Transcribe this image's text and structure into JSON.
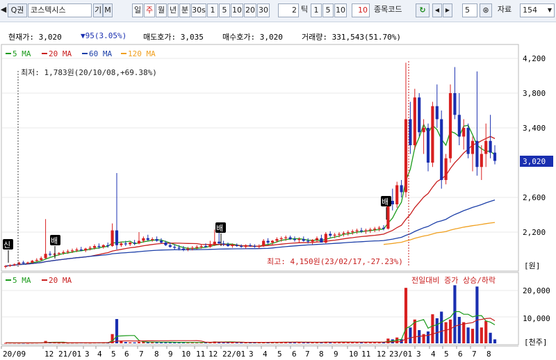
{
  "toolbar": {
    "nav_prev": "◀",
    "search_label": "Q권",
    "stock_name": "코스텍시스",
    "btn_gi": "기",
    "btn_m": "M",
    "periods": [
      "일",
      "주",
      "월",
      "년",
      "분",
      "30s"
    ],
    "period_active": "주",
    "nums1": [
      "1",
      "5",
      "10",
      "20",
      "30"
    ],
    "tick_input": "2",
    "tick_label": "틱",
    "nums2": [
      "1",
      "5",
      "10"
    ],
    "red_value": "10",
    "stock_code_label": "종목코드",
    "step_value": "5",
    "data_label": "자료",
    "data_count": "154"
  },
  "info": {
    "current_label": "현재가: 3,020",
    "change_label": "▼95(3.05%)",
    "ask_label": "매도호가: 3,035",
    "bid_label": "매수호가: 3,020",
    "volume_label": "거래량: 331,543(51.70%)"
  },
  "price_legend": [
    "5 MA",
    "20 MA",
    "60 MA",
    "120 MA"
  ],
  "volume_legend": [
    "5 MA",
    "20 MA"
  ],
  "colors": {
    "ma5": "#1a9a1a",
    "ma20": "#c81e1e",
    "ma60": "#1c3fa8",
    "ma120": "#f0a020",
    "up": "#d82020",
    "down": "#1a2fb0",
    "current_badge": "#1a2fb0"
  },
  "annotations": {
    "low": "최저: 1,783원(20/10/08,+69.38%)",
    "high": "최고: 4,150원(23/02/17,-27.23%)",
    "vol_note": "전일대비 증가 상승/하락",
    "markers": [
      "신",
      "배",
      "배",
      "배"
    ]
  },
  "axes": {
    "price_ticks": [
      "4,200",
      "3,800",
      "3,400",
      "3,020",
      "2,600",
      "2,200"
    ],
    "price_unit": "[원]",
    "volume_ticks": [
      "20,000",
      "10,000"
    ],
    "volume_unit": "[천주]",
    "x_labels": [
      "20/09",
      "12",
      "21/01",
      "3",
      "4",
      "5",
      "6",
      "7",
      "8",
      "9",
      "10",
      "11",
      "12",
      "22/01",
      "3",
      "4",
      "5",
      "6",
      "7",
      "8",
      "9",
      "10",
      "11",
      "12",
      "23/01",
      "3",
      "4",
      "5",
      "6",
      "7",
      "8"
    ]
  },
  "chart_data": [
    {
      "type": "candlestick",
      "title": "",
      "ylim": [
        1780,
        4250
      ],
      "y_ticks": [
        2200,
        2600,
        3000,
        3400,
        3800,
        4200
      ],
      "current_price": 3020,
      "low_marker": {
        "value": 1783,
        "date": "20/10/08"
      },
      "high_marker": {
        "value": 4150,
        "date": "23/02/17"
      },
      "ohlc_weekly": [
        [
          1800,
          1820,
          1783,
          1810
        ],
        [
          1810,
          1830,
          1800,
          1820
        ],
        [
          1820,
          1840,
          1810,
          1830
        ],
        [
          1830,
          1860,
          1820,
          1850
        ],
        [
          1850,
          1870,
          1830,
          1840
        ],
        [
          1840,
          1860,
          1830,
          1850
        ],
        [
          1850,
          1880,
          1840,
          1870
        ],
        [
          1870,
          1900,
          1860,
          1880
        ],
        [
          1880,
          1920,
          1870,
          1900
        ],
        [
          1900,
          2350,
          1890,
          1950
        ],
        [
          1950,
          1980,
          1920,
          1940
        ],
        [
          1940,
          1960,
          1920,
          1950
        ],
        [
          1950,
          1970,
          1930,
          1960
        ],
        [
          1960,
          1990,
          1940,
          1970
        ],
        [
          1970,
          2000,
          1950,
          1980
        ],
        [
          1980,
          2010,
          1960,
          1990
        ],
        [
          1990,
          2020,
          1970,
          2000
        ],
        [
          2000,
          2030,
          1980,
          1990
        ],
        [
          1990,
          2020,
          1970,
          2010
        ],
        [
          2010,
          2040,
          1990,
          2020
        ],
        [
          2020,
          2060,
          2000,
          2040
        ],
        [
          2040,
          2070,
          2010,
          2030
        ],
        [
          2030,
          2060,
          2010,
          2050
        ],
        [
          2050,
          2080,
          2020,
          2040
        ],
        [
          2040,
          2300,
          2030,
          2220
        ],
        [
          2220,
          2880,
          2000,
          2050
        ],
        [
          2050,
          2090,
          2030,
          2070
        ],
        [
          2070,
          2100,
          2040,
          2060
        ],
        [
          2060,
          2090,
          2040,
          2080
        ],
        [
          2080,
          2110,
          2050,
          2070
        ],
        [
          2070,
          2200,
          2060,
          2100
        ],
        [
          2100,
          2150,
          2080,
          2130
        ],
        [
          2130,
          2170,
          2100,
          2110
        ],
        [
          2110,
          2140,
          2090,
          2120
        ],
        [
          2120,
          2150,
          2090,
          2100
        ],
        [
          2100,
          2130,
          2070,
          2080
        ],
        [
          2080,
          2100,
          2040,
          2050
        ],
        [
          2050,
          2080,
          2020,
          2030
        ],
        [
          2030,
          2060,
          2000,
          2020
        ],
        [
          2020,
          2050,
          1990,
          2010
        ],
        [
          2010,
          2040,
          1980,
          2000
        ],
        [
          2000,
          2030,
          1980,
          2010
        ],
        [
          2010,
          2040,
          1990,
          2020
        ],
        [
          2020,
          2050,
          2000,
          2030
        ],
        [
          2030,
          2060,
          2010,
          2040
        ],
        [
          2040,
          2070,
          2020,
          2030
        ],
        [
          2030,
          2100,
          2020,
          2060
        ],
        [
          2060,
          2230,
          2040,
          2090
        ],
        [
          2090,
          2200,
          2060,
          2070
        ],
        [
          2070,
          2100,
          2040,
          2060
        ],
        [
          2060,
          2080,
          2030,
          2040
        ],
        [
          2040,
          2070,
          2020,
          2050
        ],
        [
          2050,
          2070,
          2030,
          2040
        ],
        [
          2040,
          2060,
          2020,
          2030
        ],
        [
          2030,
          2060,
          2010,
          2050
        ],
        [
          2050,
          2070,
          2030,
          2040
        ],
        [
          2040,
          2060,
          2020,
          2030
        ],
        [
          2030,
          2060,
          2010,
          2040
        ],
        [
          2040,
          2120,
          2030,
          2100
        ],
        [
          2100,
          2130,
          2060,
          2080
        ],
        [
          2080,
          2110,
          2050,
          2100
        ],
        [
          2100,
          2140,
          2080,
          2120
        ],
        [
          2120,
          2150,
          2090,
          2130
        ],
        [
          2130,
          2160,
          2100,
          2140
        ],
        [
          2140,
          2160,
          2110,
          2120
        ],
        [
          2120,
          2150,
          2090,
          2110
        ],
        [
          2110,
          2140,
          2080,
          2120
        ],
        [
          2120,
          2150,
          2090,
          2100
        ],
        [
          2100,
          2130,
          2070,
          2090
        ],
        [
          2090,
          2120,
          2060,
          2110
        ],
        [
          2110,
          2150,
          2080,
          2130
        ],
        [
          2130,
          2170,
          2100,
          2080
        ],
        [
          2080,
          2200,
          2070,
          2180
        ],
        [
          2180,
          2210,
          2140,
          2160
        ],
        [
          2160,
          2190,
          2130,
          2170
        ],
        [
          2170,
          2200,
          2140,
          2180
        ],
        [
          2180,
          2210,
          2150,
          2190
        ],
        [
          2190,
          2220,
          2160,
          2200
        ],
        [
          2200,
          2230,
          2170,
          2210
        ],
        [
          2210,
          2240,
          2180,
          2220
        ],
        [
          2220,
          2250,
          2190,
          2210
        ],
        [
          2210,
          2240,
          2180,
          2220
        ],
        [
          2220,
          2250,
          2190,
          2230
        ],
        [
          2230,
          2260,
          2200,
          2240
        ],
        [
          2240,
          2270,
          2210,
          2250
        ],
        [
          2250,
          2280,
          2220,
          2240
        ],
        [
          2240,
          2600,
          2230,
          2560
        ],
        [
          2560,
          2700,
          2450,
          2520
        ],
        [
          2520,
          2780,
          2480,
          2740
        ],
        [
          2740,
          2800,
          2600,
          2660
        ],
        [
          2660,
          4150,
          2600,
          3500
        ],
        [
          3500,
          3700,
          3100,
          3200
        ],
        [
          3200,
          3850,
          3150,
          3750
        ],
        [
          3750,
          3800,
          3300,
          3350
        ],
        [
          3350,
          3500,
          3100,
          3400
        ],
        [
          3400,
          3450,
          2900,
          3000
        ],
        [
          3000,
          3700,
          2950,
          3650
        ],
        [
          3650,
          3900,
          3400,
          3500
        ],
        [
          3500,
          3600,
          2700,
          2800
        ],
        [
          2800,
          3100,
          2750,
          3050
        ],
        [
          3050,
          3900,
          3000,
          3800
        ],
        [
          3800,
          4100,
          3500,
          3550
        ],
        [
          3550,
          3800,
          3200,
          3300
        ],
        [
          3300,
          3500,
          3150,
          3400
        ],
        [
          3400,
          3450,
          3050,
          3100
        ],
        [
          3100,
          3300,
          2900,
          3250
        ],
        [
          3250,
          4050,
          2850,
          2950
        ],
        [
          2950,
          3200,
          2800,
          3100
        ],
        [
          3100,
          3450,
          2950,
          3250
        ],
        [
          3250,
          3550,
          3050,
          3115
        ],
        [
          3115,
          3200,
          2980,
          3020
        ]
      ]
    },
    {
      "type": "bar",
      "title": "",
      "ylabel": "[천주]",
      "ylim": [
        0,
        24000
      ],
      "y_ticks": [
        10000,
        20000
      ],
      "volume_weekly": [
        150,
        200,
        180,
        160,
        170,
        150,
        200,
        220,
        260,
        900,
        300,
        250,
        200,
        220,
        180,
        200,
        210,
        250,
        230,
        200,
        240,
        260,
        230,
        220,
        3500,
        9200,
        800,
        500,
        400,
        350,
        600,
        550,
        500,
        480,
        420,
        400,
        380,
        360,
        340,
        320,
        300,
        310,
        320,
        330,
        340,
        330,
        360,
        700,
        600,
        420,
        380,
        360,
        340,
        330,
        320,
        310,
        300,
        320,
        500,
        420,
        400,
        420,
        440,
        460,
        430,
        410,
        400,
        390,
        380,
        370,
        420,
        380,
        600,
        500,
        480,
        460,
        450,
        440,
        430,
        420,
        410,
        400,
        420,
        440,
        460,
        500,
        1800,
        1500,
        2200,
        1600,
        21000,
        6000,
        9000,
        5000,
        3500,
        4500,
        11000,
        9500,
        12000,
        8000,
        9000,
        22000,
        10000,
        8000,
        6000,
        5500,
        21500,
        6000,
        8500,
        4000,
        1500
      ],
      "ma5_volume": [
        200,
        200,
        190,
        180,
        170,
        165,
        175,
        185,
        200,
        350,
        380,
        390,
        400,
        420,
        230,
        210,
        205,
        210,
        215,
        220,
        230,
        240,
        240,
        240,
        900,
        2700,
        2800,
        2900,
        2950,
        2950,
        1100,
        600,
        500,
        480,
        470,
        460,
        440,
        420,
        400,
        380,
        360,
        340,
        330,
        320,
        330,
        340,
        360,
        420,
        480,
        500,
        520,
        520,
        480,
        420,
        380,
        360,
        340,
        330,
        340,
        350,
        360,
        380,
        400,
        420,
        440,
        440,
        430,
        420,
        410,
        400,
        400,
        400,
        420,
        440,
        460,
        480,
        490,
        480,
        470,
        460,
        450,
        440,
        430,
        430,
        440,
        450,
        700,
        900,
        1200,
        1500,
        5600,
        6500,
        8000,
        8500,
        9000,
        5700,
        6600,
        7000,
        8000,
        9000,
        9900,
        12000,
        12000,
        11000,
        11000,
        10000,
        10500,
        10500,
        8500,
        8000,
        7000
      ]
    }
  ]
}
